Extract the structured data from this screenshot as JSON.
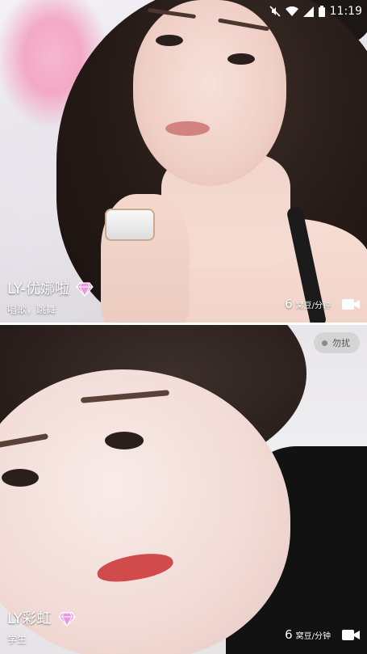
{
  "status_bar": {
    "time": "11:19",
    "icons": [
      "mute-icon",
      "wifi-icon",
      "signal-icon",
      "battery-icon"
    ]
  },
  "feed": [
    {
      "name": "LY-优娜啦",
      "tags": "唱歌，跳舞",
      "price": "6",
      "price_unit": "窝豆/分钟",
      "badge_icon": "diamond-icon",
      "call_icon": "video-call-icon"
    },
    {
      "name": "LY彩虹",
      "tags": "学生",
      "price": "6",
      "price_unit": "窝豆/分钟",
      "status": "勿扰",
      "badge_icon": "diamond-icon",
      "call_icon": "video-call-icon"
    }
  ],
  "colors": {
    "text_on_photo": "#ffffff",
    "gem": "#e89adf",
    "dnd_background": "#cdcdcd",
    "dnd_text": "#555555"
  }
}
